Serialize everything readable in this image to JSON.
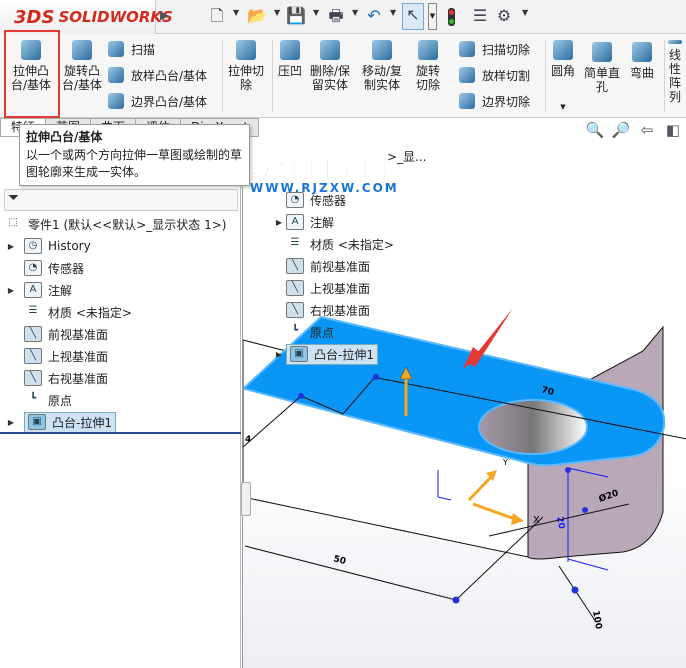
{
  "app": {
    "logo_text": "SOLIDWORKS",
    "logo_prefix": "3DS"
  },
  "toolbar": {
    "icons": [
      "new-document-icon",
      "open-icon",
      "save-icon",
      "print-icon",
      "undo-icon",
      "select-pointer-icon",
      "rebuild-traffic-light-icon",
      "file-properties-icon",
      "options-gear-icon"
    ]
  },
  "ribbon": {
    "extruded_boss": "拉伸凸台/基体",
    "revolved_boss": "旋转凸台/基体",
    "sweep": "扫描",
    "loft": "放样凸台/基体",
    "boundary": "边界凸台/基体",
    "extruded_cut": "拉伸切除",
    "indent": "压凹",
    "delete_keep_body": "删除/保留实体",
    "move_copy_body": "移动/复制实体",
    "revolved_cut": "旋转切除",
    "swept_cut": "扫描切除",
    "lofted_cut": "放样切割",
    "boundary_cut": "边界切除",
    "fillet": "圆角",
    "simple_hole": "简单直孔",
    "flex": "弯曲",
    "linear_pattern": "线性阵列"
  },
  "tabs": [
    "特征",
    "草图",
    "曲面",
    "评估",
    "DimXpert"
  ],
  "tooltip": {
    "title": "拉伸凸台/基体",
    "body": "以一个或两个方向拉伸一草图或绘制的草图轮廓来生成一实体。"
  },
  "tree": {
    "root": "零件1  (默认<<默认>_显示状态 1>)",
    "items": [
      {
        "label": "History",
        "expandable": true,
        "icon": "history-folder-icon"
      },
      {
        "label": "传感器",
        "expandable": false,
        "icon": "sensor-folder-icon"
      },
      {
        "label": "注解",
        "expandable": true,
        "icon": "annotation-folder-icon"
      },
      {
        "label": "材质 <未指定>",
        "expandable": false,
        "icon": "material-icon"
      },
      {
        "label": "前视基准面",
        "expandable": false,
        "icon": "plane-icon"
      },
      {
        "label": "上视基准面",
        "expandable": false,
        "icon": "plane-icon"
      },
      {
        "label": "右视基准面",
        "expandable": false,
        "icon": "plane-icon"
      },
      {
        "label": "原点",
        "expandable": false,
        "icon": "origin-icon"
      },
      {
        "label": "凸台-拉伸1",
        "expandable": true,
        "icon": "extrude-feature-icon",
        "selected": true
      }
    ]
  },
  "viewport": {
    "root_partial": ">_显...",
    "watermark": "软件自学网",
    "watermark_url": "WWW.RJZXW.COM",
    "dimensions": [
      "70",
      "Ø20",
      "20",
      "50",
      "100",
      "4"
    ],
    "axis_label": "Y",
    "triad_label": "X",
    "colors": {
      "selected_face": "#0a96f5",
      "arrow": "#e53935",
      "handle": "#f5a623"
    }
  }
}
